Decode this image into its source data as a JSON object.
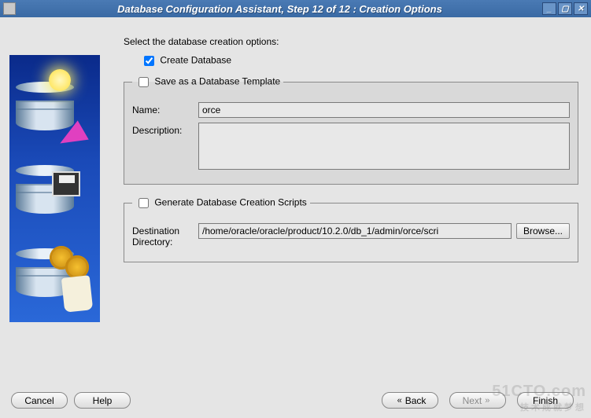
{
  "window": {
    "title": "Database Configuration Assistant, Step 12 of 12 : Creation Options"
  },
  "main": {
    "prompt": "Select the database creation options:",
    "create_db": {
      "label": "Create Database",
      "checked": true
    },
    "save_template": {
      "legend": "Save as a Database Template",
      "checked": false,
      "name_label": "Name:",
      "name_value": "orce",
      "desc_label": "Description:",
      "desc_value": ""
    },
    "gen_scripts": {
      "legend": "Generate Database Creation Scripts",
      "checked": false,
      "dest_label": "Destination Directory:",
      "dest_value": "/home/oracle/oracle/product/10.2.0/db_1/admin/orce/scri",
      "browse_label": "Browse..."
    }
  },
  "footer": {
    "cancel": "Cancel",
    "help": "Help",
    "back": "Back",
    "next": "Next",
    "finish": "Finish"
  },
  "watermark": {
    "line1": "51CTO.com",
    "line2": "技术成就梦想"
  }
}
